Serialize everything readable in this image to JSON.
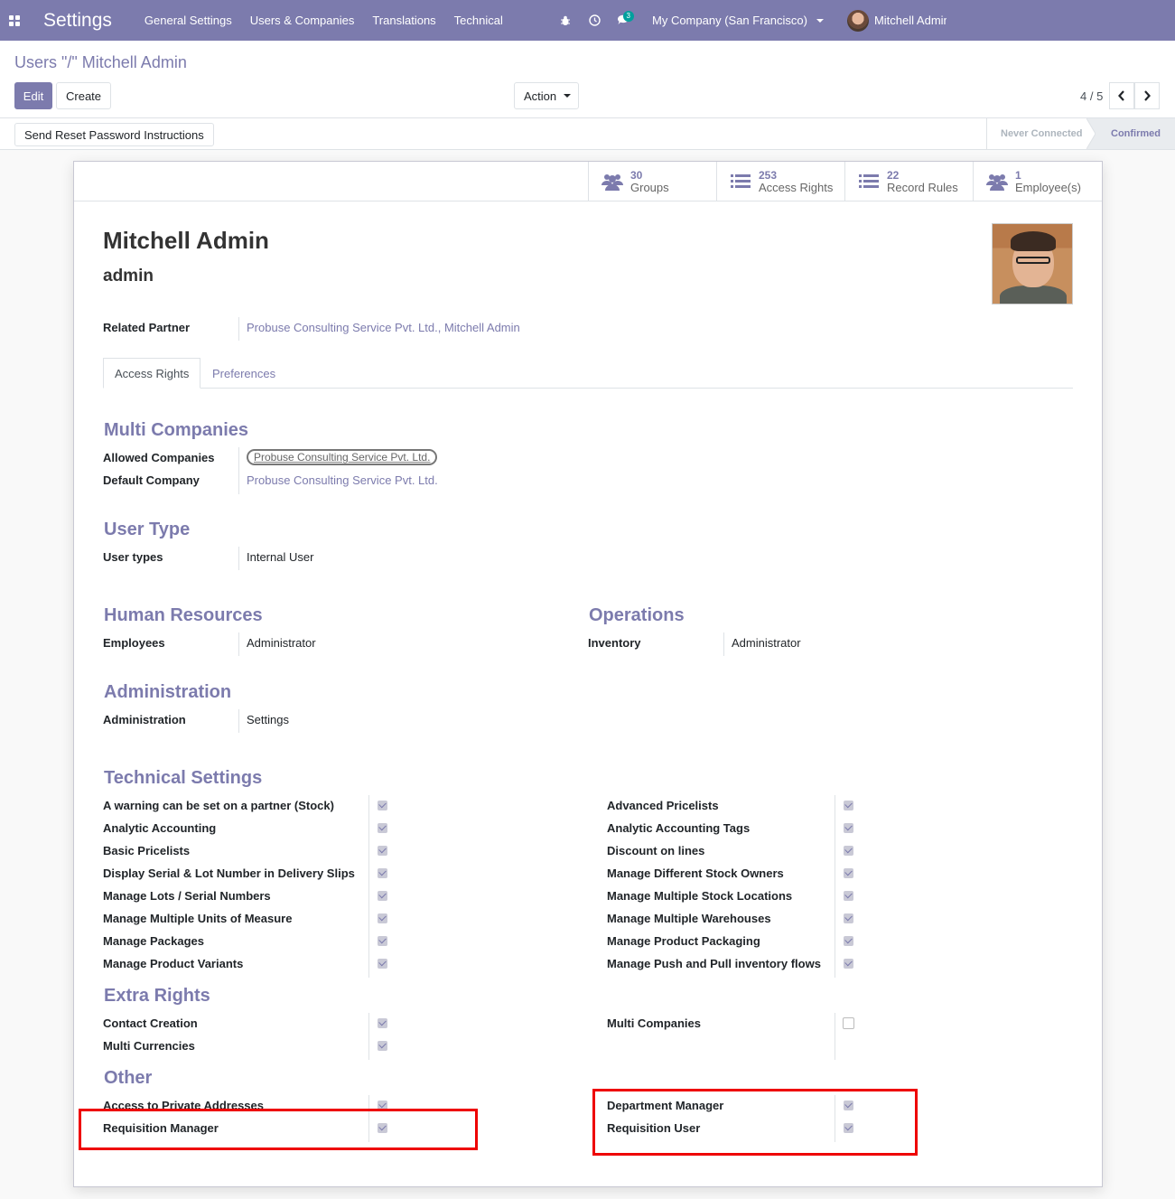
{
  "navbar": {
    "app_title": "Settings",
    "menu": [
      "General Settings",
      "Users & Companies",
      "Translations",
      "Technical"
    ],
    "message_count": "3",
    "company": "My Company (San Francisco)",
    "user": "Mitchell Admin",
    "color": "#7c7bad"
  },
  "control": {
    "breadcrumb": "Users \"/\" Mitchell Admin",
    "edit_label": "Edit",
    "create_label": "Create",
    "action_label": "Action",
    "pager": "4 / 5"
  },
  "statusbar": {
    "reset_label": "Send Reset Password Instructions",
    "stages": [
      "Never Connected",
      "Confirmed"
    ],
    "active_stage": "Confirmed"
  },
  "stat_buttons": [
    {
      "value": "30",
      "label": "Groups",
      "icon": "users-icon"
    },
    {
      "value": "253",
      "label": "Access Rights",
      "icon": "list-icon"
    },
    {
      "value": "22",
      "label": "Record Rules",
      "icon": "list-icon"
    },
    {
      "value": "1",
      "label": "Employee(s)",
      "icon": "users-icon"
    }
  ],
  "user": {
    "name": "Mitchell Admin",
    "login": "admin",
    "related_partner_label": "Related Partner",
    "related_partner": "Probuse Consulting Service Pvt. Ltd., Mitchell Admin"
  },
  "tabs": [
    "Access Rights",
    "Preferences"
  ],
  "multi_companies": {
    "title": "Multi Companies",
    "allowed_label": "Allowed Companies",
    "allowed_tag": "Probuse Consulting Service Pvt. Ltd.",
    "default_label": "Default Company",
    "default_value": "Probuse Consulting Service Pvt. Ltd."
  },
  "user_type": {
    "title": "User Type",
    "label": "User types",
    "value": "Internal User"
  },
  "human_resources": {
    "title": "Human Resources",
    "label": "Employees",
    "value": "Administrator"
  },
  "operations": {
    "title": "Operations",
    "label": "Inventory",
    "value": "Administrator"
  },
  "administration": {
    "title": "Administration",
    "label": "Administration",
    "value": "Settings"
  },
  "technical": {
    "title": "Technical Settings",
    "left": [
      "A warning can be set on a partner (Stock)",
      "Analytic Accounting",
      "Basic Pricelists",
      "Display Serial & Lot Number in Delivery Slips",
      "Manage Lots / Serial Numbers",
      "Manage Multiple Units of Measure",
      "Manage Packages",
      "Manage Product Variants"
    ],
    "right": [
      "Advanced Pricelists",
      "Analytic Accounting Tags",
      "Discount on lines",
      "Manage Different Stock Owners",
      "Manage Multiple Stock Locations",
      "Manage Multiple Warehouses",
      "Manage Product Packaging",
      "Manage Push and Pull inventory flows"
    ]
  },
  "extra": {
    "title": "Extra Rights",
    "left": [
      "Contact Creation",
      "Multi Currencies"
    ],
    "right": [
      "Multi Companies"
    ]
  },
  "other": {
    "title": "Other",
    "left": [
      "Access to Private Addresses",
      "Requisition Manager"
    ],
    "right": [
      "Department Manager",
      "Requisition User"
    ]
  }
}
